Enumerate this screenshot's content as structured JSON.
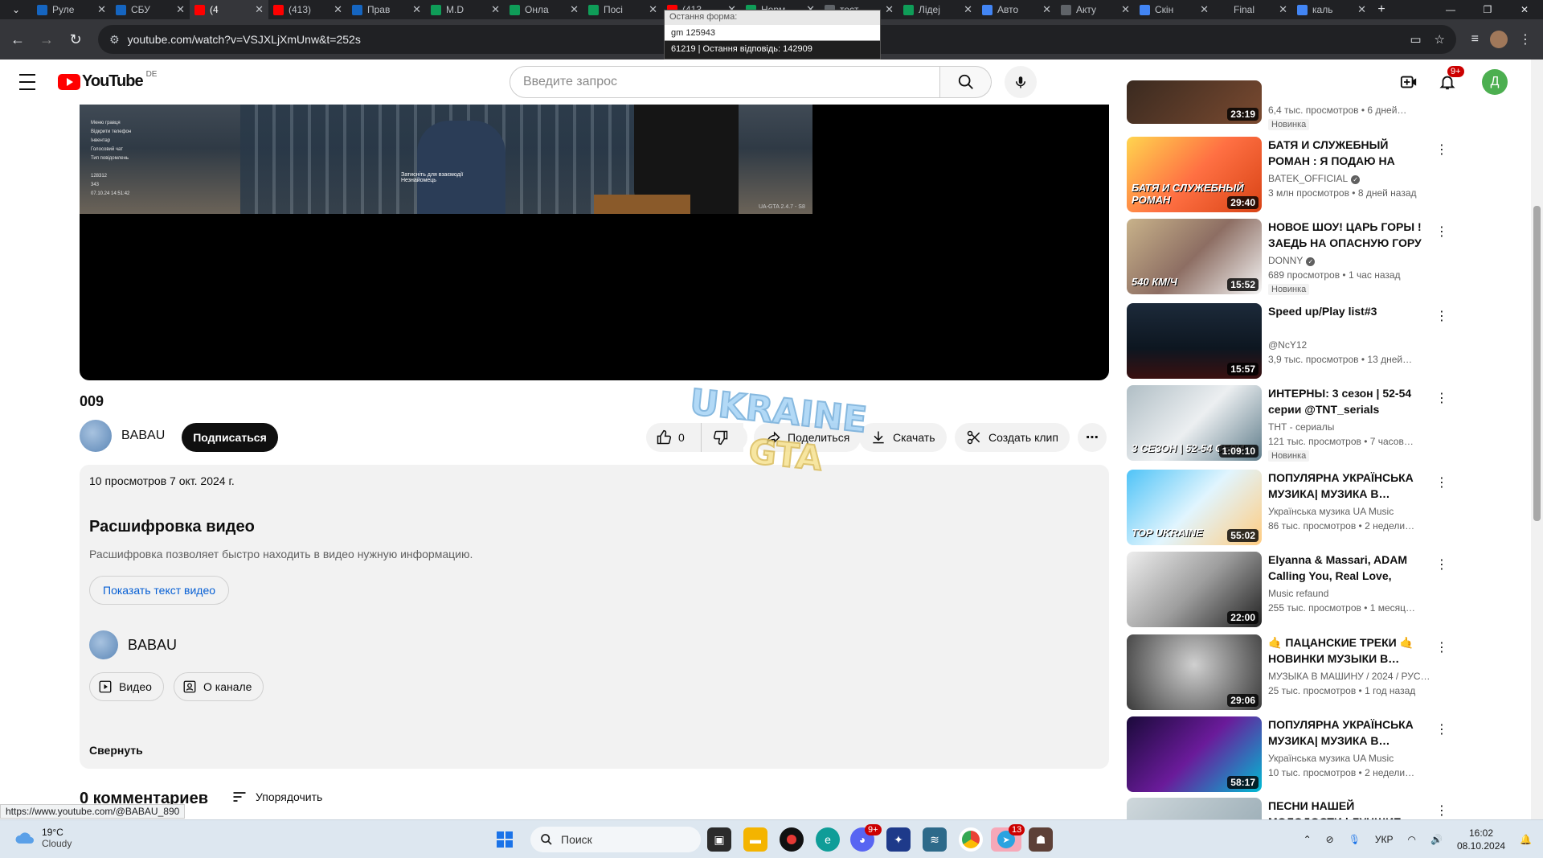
{
  "browser": {
    "tabs": [
      {
        "label": "Руле",
        "color": "#1565c0"
      },
      {
        "label": "СБУ",
        "color": "#1565c0"
      },
      {
        "label": "(4",
        "color": "#ff0000",
        "active": true
      },
      {
        "label": "(413)",
        "color": "#ff0000"
      },
      {
        "label": "Прав",
        "color": "#1565c0"
      },
      {
        "label": "M.D",
        "color": "#0f9d58"
      },
      {
        "label": "Онла",
        "color": "#0f9d58"
      },
      {
        "label": "Посі",
        "color": "#0f9d58"
      },
      {
        "label": "(413",
        "color": "#ff0000"
      },
      {
        "label": "Норм",
        "color": "#0f9d58"
      },
      {
        "label": "тест",
        "color": "#5f6368"
      },
      {
        "label": "Лідеј",
        "color": "#0f9d58"
      },
      {
        "label": "Авто",
        "color": "#4285f4"
      },
      {
        "label": "Акту",
        "color": "#5f6368"
      },
      {
        "label": "Скін",
        "color": "#4285f4"
      },
      {
        "label": "Final",
        "color": "#202124"
      },
      {
        "label": "каль",
        "color": "#4285f4"
      }
    ],
    "url": "youtube.com/watch?v=VSJXLjXmUnw&t=252s"
  },
  "popup": {
    "header": "Остання форма:",
    "line": "gm 125943",
    "footer": "61219  |  Остання відповідь: 142909"
  },
  "header": {
    "logo_text": "YouTube",
    "country": "DE",
    "search_placeholder": "Введите запрос",
    "notifications": "9+",
    "avatar_letter": "Д"
  },
  "video": {
    "title": "009",
    "hud_lines": [
      "Меню гравця",
      "Відкрити телефон",
      "Інвентар",
      "Голосовий чат",
      "Тип повідомлень",
      "",
      "128312",
      "343",
      "07.10.24 14:51:42"
    ],
    "hud_note": "Затисніть для взаємодії\nНезнайомець",
    "hud_version": "UA-GTA 2.4.7 - S8"
  },
  "channel": {
    "name": "BABAU",
    "subscribe_label": "Подписаться"
  },
  "actions": {
    "likes": "0",
    "share": "Поделиться",
    "download": "Скачать",
    "clip": "Создать клип",
    "more": "⋯"
  },
  "watermark_text": [
    "UKRAINE",
    "GTA"
  ],
  "description": {
    "meta": "10 просмотров  7 окт. 2024 г.",
    "transcript_title": "Расшифровка видео",
    "transcript_subtitle": "Расшифровка позволяет быстро находить в видео нужную информацию.",
    "transcript_button": "Показать текст видео",
    "channel_name": "BABAU",
    "videos_button": "Видео",
    "about_button": "О канале",
    "collapse": "Свернуть"
  },
  "comments": {
    "count_label": "0 комментариев",
    "sort_label": "Упорядочить"
  },
  "status_url": "https://www.youtube.com/@BABAU_890",
  "sidebar": [
    {
      "title": "",
      "channel": "",
      "meta": "6,4 тыс. просмотров  •  6 дней…",
      "new": "Новинка",
      "duration": "23:19",
      "bg": "linear-gradient(135deg,#3a2a20,#7a4a30)",
      "partial": true
    },
    {
      "title": "БАТЯ И СЛУЖЕБНЫЙ РОМАН : Я ПОДАЮ НА РАЗВОД!",
      "channel": "BATEK_OFFICIAL",
      "verified": true,
      "meta": "3 млн просмотров  •  8 дней назад",
      "new": "",
      "duration": "29:40",
      "bg": "linear-gradient(135deg,#ffd54f,#ff7043,#d84315)",
      "overlay": "БАТЯ И СЛУЖЕБНЫЙ РОМАН"
    },
    {
      "title": "НОВОЕ ШОУ! ЦАРЬ ГОРЫ ! ЗАЕДЬ НА ОПАСНУЮ ГОРУ …",
      "channel": "DONNY",
      "verified": true,
      "meta": "689 просмотров  •  1 час назад",
      "new": "Новинка",
      "duration": "15:52",
      "bg": "linear-gradient(135deg,#c8b28a,#8d6e63,#f5f5f5)",
      "overlay": "540 КМ/Ч"
    },
    {
      "title": "Speed up/Play list#3",
      "channel": "@NcY12",
      "meta": "3,9 тыс. просмотров  •  13 дней…",
      "new": "",
      "duration": "15:57",
      "bg": "linear-gradient(180deg,#1c2a3a,#0d1620 60%,#3a1010)"
    },
    {
      "title": "ИНТЕРНЫ: 3 сезон | 52-54 серии @TNT_serials",
      "channel": "ТНТ - сериалы",
      "meta": "121 тыс. просмотров  •  7 часов…",
      "new": "Новинка",
      "duration": "1:09:10",
      "bg": "linear-gradient(135deg,#b0bec5,#eceff1,#607d8b)",
      "overlay": "3 СЕЗОН | 52-54 СЕРИ"
    },
    {
      "title": "ПОПУЛЯРНА УКРАЇНСЬКА МУЗИКА| МУЗИКА В…",
      "channel": "Українська музика UA Music",
      "meta": "86 тыс. просмотров  •  2 недели…",
      "new": "",
      "duration": "55:02",
      "bg": "linear-gradient(135deg,#4fc3f7,#e1f5fe,#ffcc80)",
      "overlay": "TOP UKRAINE"
    },
    {
      "title": "Elyanna & Massari, ADAM Calling You, Real Love, ZHURE…",
      "channel": "Music refaund",
      "meta": "255 тыс. просмотров  •  1 месяц…",
      "new": "",
      "duration": "22:00",
      "bg": "linear-gradient(135deg,#eeeeee,#9e9e9e,#212121)"
    },
    {
      "title": "🤙 ПАЦАНСКИЕ ТРЕКИ 🤙 НОВИНКИ МУЗЫКИ В…",
      "channel": "МУЗЫКА В МАШИНУ / 2024 / РУС…",
      "meta": "25 тыс. просмотров  •  1 год назад",
      "new": "",
      "duration": "29:06",
      "bg": "radial-gradient(circle at 50% 40%,#d0d0d0,#3a3a3a)"
    },
    {
      "title": "ПОПУЛЯРНА УКРАЇНСЬКА МУЗИКА| МУЗИКА В…",
      "channel": "Українська музика UA Music",
      "meta": "10 тыс. просмотров  •  2 недели…",
      "new": "",
      "duration": "58:17",
      "bg": "linear-gradient(135deg,#1a0a3a,#6a1b9a,#00bcd4)"
    },
    {
      "title": "ПЕСНИ НАШЕЙ МОЛОДОСТИ | ЛУЧШИЕ ВЕЧНЫЕ ХИТЫ…",
      "channel": "",
      "meta": "",
      "new": "",
      "duration": "",
      "bg": "linear-gradient(135deg,#cfd8dc,#90a4ae)"
    }
  ],
  "taskbar": {
    "temp": "19°C",
    "weather": "Cloudy",
    "search": "Поиск",
    "lang": "УКР",
    "time": "16:02",
    "date": "08.10.2024",
    "telegram_badge": "13",
    "discord_badge": "9+"
  }
}
